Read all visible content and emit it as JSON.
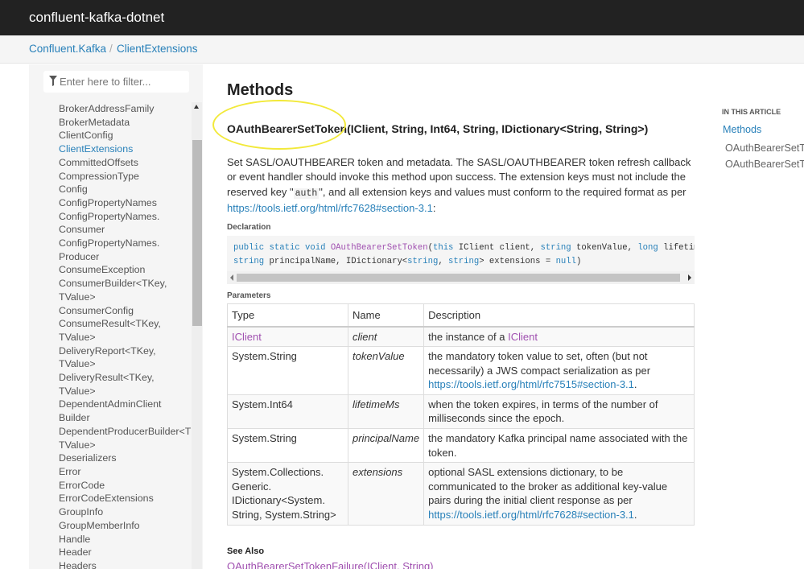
{
  "header": {
    "brand": "confluent-kafka-dotnet"
  },
  "breadcrumb": {
    "items": [
      "Confluent.Kafka",
      "ClientExtensions"
    ],
    "separator": "/"
  },
  "sidebar": {
    "filter_placeholder": "Enter here to filter...",
    "items": [
      "BrokerAddressFamily",
      "BrokerMetadata",
      "ClientConfig",
      "ClientExtensions",
      "CommittedOffsets",
      "CompressionType",
      "Config",
      "ConfigPropertyNames",
      "ConfigPropertyNames.",
      "Consumer",
      "ConfigPropertyNames.",
      "Producer",
      "ConsumeException",
      "ConsumerBuilder<TKey,",
      "TValue>",
      "ConsumerConfig",
      "ConsumeResult<TKey,",
      "TValue>",
      "DeliveryReport<TKey,",
      "TValue>",
      "DeliveryResult<TKey,",
      "TValue>",
      "DependentAdminClient",
      "Builder",
      "DependentProducerBuilder<TKey,",
      "TValue>",
      "Deserializers",
      "Error",
      "ErrorCode",
      "ErrorCodeExtensions",
      "GroupInfo",
      "GroupMemberInfo",
      "Handle",
      "Header",
      "Headers"
    ],
    "active_item": "ClientExtensions"
  },
  "main": {
    "section_title": "Methods",
    "method_signature": "OAuthBearerSetToken(IClient, String, Int64, String, IDictionary<String, String>)",
    "description": {
      "part1": "Set SASL/OAUTHBEARER token and metadata. The SASL/OAUTHBEARER token refresh callback or event handler should invoke this method upon success. The extension keys must not include the reserved key \"",
      "code": "auth",
      "part2": "\", and all extension keys and values must conform to the required format as per ",
      "link": "https://tools.ietf.org/html/rfc7628#section-3.1",
      "part3": ":"
    },
    "declaration_heading": "Declaration",
    "declaration": {
      "line1": [
        {
          "t": "public",
          "k": "kw"
        },
        {
          "t": " ",
          "k": ""
        },
        {
          "t": "static",
          "k": "kw"
        },
        {
          "t": " ",
          "k": ""
        },
        {
          "t": "void",
          "k": "kw"
        },
        {
          "t": " ",
          "k": ""
        },
        {
          "t": "OAuthBearerSetToken",
          "k": "fn"
        },
        {
          "t": "(",
          "k": ""
        },
        {
          "t": "this",
          "k": "kw"
        },
        {
          "t": " IClient client, ",
          "k": ""
        },
        {
          "t": "string",
          "k": "kw"
        },
        {
          "t": " tokenValue, ",
          "k": ""
        },
        {
          "t": "long",
          "k": "kw"
        },
        {
          "t": " lifetimeMs,",
          "k": ""
        }
      ],
      "line2": [
        {
          "t": "string",
          "k": "kw"
        },
        {
          "t": " principalName, IDictionary<",
          "k": ""
        },
        {
          "t": "string",
          "k": "kw"
        },
        {
          "t": ", ",
          "k": ""
        },
        {
          "t": "string",
          "k": "kw"
        },
        {
          "t": "> extensions = ",
          "k": ""
        },
        {
          "t": "null",
          "k": "kw"
        },
        {
          "t": ")",
          "k": ""
        }
      ]
    },
    "parameters_heading": "Parameters",
    "params_table": {
      "headers": [
        "Type",
        "Name",
        "Description"
      ],
      "rows": [
        {
          "type": "IClient",
          "type_link": true,
          "name": "client",
          "desc": "the instance of a ",
          "desc_link": "IClient",
          "desc_after": ""
        },
        {
          "type": "System.String",
          "type_link": false,
          "name": "tokenValue",
          "desc": "the mandatory token value to set, often (but not necessarily) a JWS compact serialization as per ",
          "desc_link": "https://tools.ietf.org/html/rfc7515#section-3.1",
          "desc_after": "."
        },
        {
          "type": "System.Int64",
          "type_link": false,
          "name": "lifetimeMs",
          "desc": "when the token expires, in terms of the number of milliseconds since the epoch.",
          "desc_link": "",
          "desc_after": ""
        },
        {
          "type": "System.String",
          "type_link": false,
          "name": "principalName",
          "desc": "the mandatory Kafka principal name associated with the token.",
          "desc_link": "",
          "desc_after": ""
        },
        {
          "type": "System.Collections.\nGeneric.\nIDictionary<System.\nString, System.String>",
          "type_link": false,
          "name": "extensions",
          "desc": "optional SASL extensions dictionary, to be communicated to the broker as additional key-value pairs during the initial client response as per ",
          "desc_link": "https://tools.ietf.org/html/rfc7628#section-3.1",
          "desc_after": "."
        }
      ]
    },
    "see_also_heading": "See Also",
    "see_also_link": "OAuthBearerSetTokenFailure(IClient, String)"
  },
  "in_this_article": {
    "heading": "IN THIS ARTICLE",
    "section_link": "Methods",
    "items": [
      "OAuthBearerSetToken",
      "OAuthBearerSetTokenFailure"
    ]
  },
  "colors": {
    "link": "#2880b9",
    "violet_link": "#a050b0",
    "topbar": "#222222",
    "highlight": "#f2e93a"
  }
}
